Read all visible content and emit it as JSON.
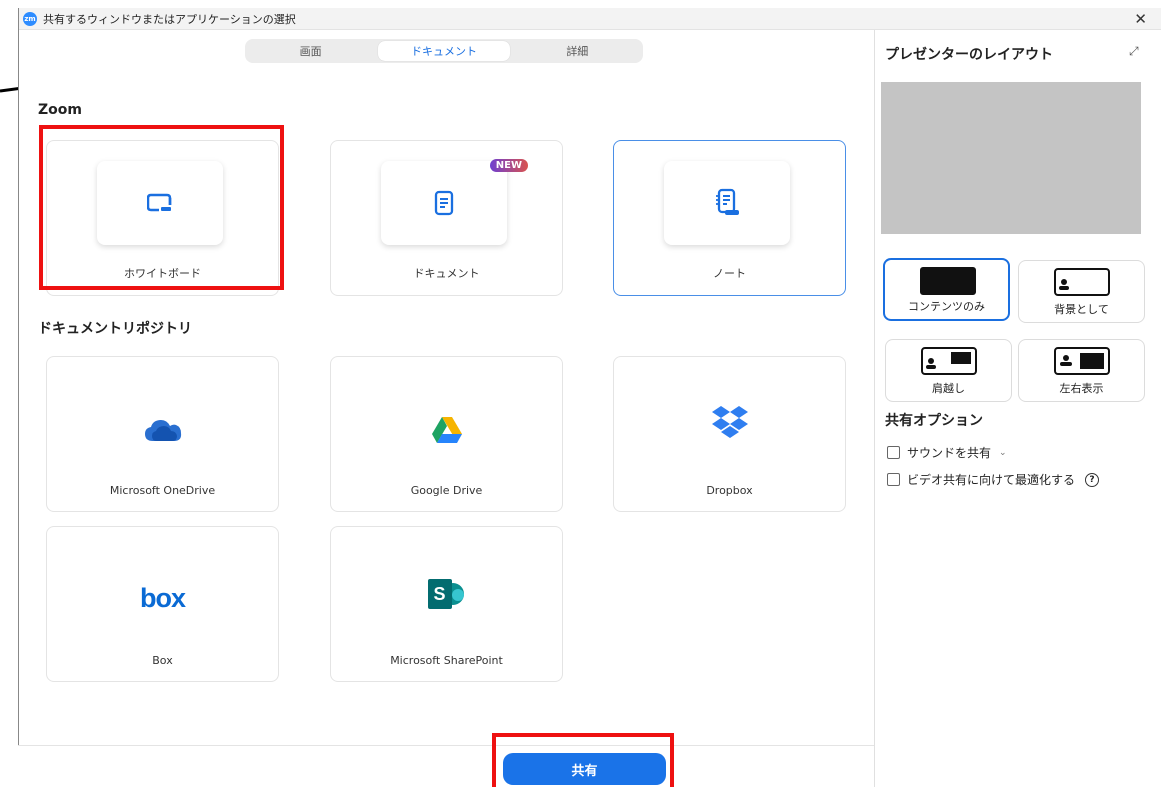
{
  "window": {
    "app_icon": "zm",
    "title": "共有するウィンドウまたはアプリケーションの選択",
    "close": "✕"
  },
  "tabs": [
    {
      "label": "画面",
      "active": false
    },
    {
      "label": "ドキュメント",
      "active": true
    },
    {
      "label": "詳細",
      "active": false
    }
  ],
  "zoom_section": {
    "title": "Zoom",
    "cards": [
      {
        "label": "ホワイトボード",
        "icon": "whiteboard-icon"
      },
      {
        "label": "ドキュメント",
        "icon": "docs-icon",
        "badge": "NEW"
      },
      {
        "label": "ノート",
        "icon": "notes-icon"
      }
    ]
  },
  "repo_section": {
    "title": "ドキュメントリポジトリ",
    "cards": [
      {
        "label": "Microsoft OneDrive",
        "icon": "onedrive-icon"
      },
      {
        "label": "Google Drive",
        "icon": "google-drive-icon"
      },
      {
        "label": "Dropbox",
        "icon": "dropbox-icon"
      },
      {
        "label": "Box",
        "icon": "box-icon",
        "logo_text": "box"
      },
      {
        "label": "Microsoft SharePoint",
        "icon": "sharepoint-icon",
        "logo_text": "S"
      }
    ]
  },
  "right_panel": {
    "title": "プレゼンターのレイアウト",
    "expand": "⤢",
    "layouts": [
      {
        "label": "コンテンツのみ",
        "active": true
      },
      {
        "label": "背景として",
        "active": false
      },
      {
        "label": "肩越し",
        "active": false
      },
      {
        "label": "左右表示",
        "active": false
      }
    ],
    "options_title": "共有オプション",
    "options": [
      {
        "label": "サウンドを共有",
        "checked": false,
        "has_dropdown": true
      },
      {
        "label": "ビデオ共有に向けて最適化する",
        "checked": false,
        "has_help": true
      }
    ],
    "help_glyph": "?",
    "chevron_glyph": "⌄"
  },
  "footer": {
    "share_label": "共有"
  },
  "colors": {
    "accent": "#1a73e8",
    "highlight_box": "#ee1111",
    "preview_gray": "#c4c4c4"
  }
}
